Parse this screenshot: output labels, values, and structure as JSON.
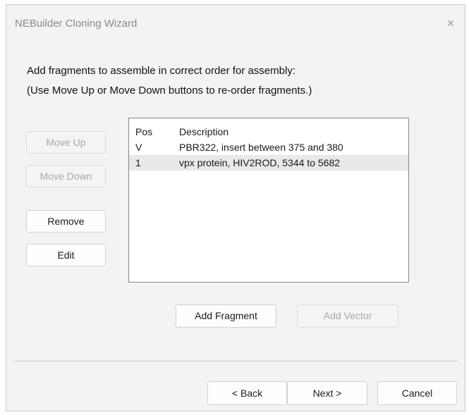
{
  "window": {
    "title": "NEBuilder Cloning Wizard",
    "close_glyph": "×"
  },
  "instructions": {
    "line1": "Add fragments to assemble in correct order for assembly:",
    "line2": "(Use Move Up or Move Down buttons to re-order fragments.)"
  },
  "buttons": {
    "move_up": "Move Up",
    "move_down": "Move Down",
    "remove": "Remove",
    "edit": "Edit",
    "add_fragment": "Add Fragment",
    "add_vector": "Add Vector",
    "back": "< Back",
    "next": "Next >",
    "cancel": "Cancel"
  },
  "fragment_list": {
    "headers": {
      "pos": "Pos",
      "description": "Description"
    },
    "rows": [
      {
        "pos": "V",
        "description": "PBR322, insert between 375 and 380",
        "selected": false
      },
      {
        "pos": "1",
        "description": "vpx protein, HIV2ROD, 5344 to 5682",
        "selected": true
      }
    ]
  }
}
